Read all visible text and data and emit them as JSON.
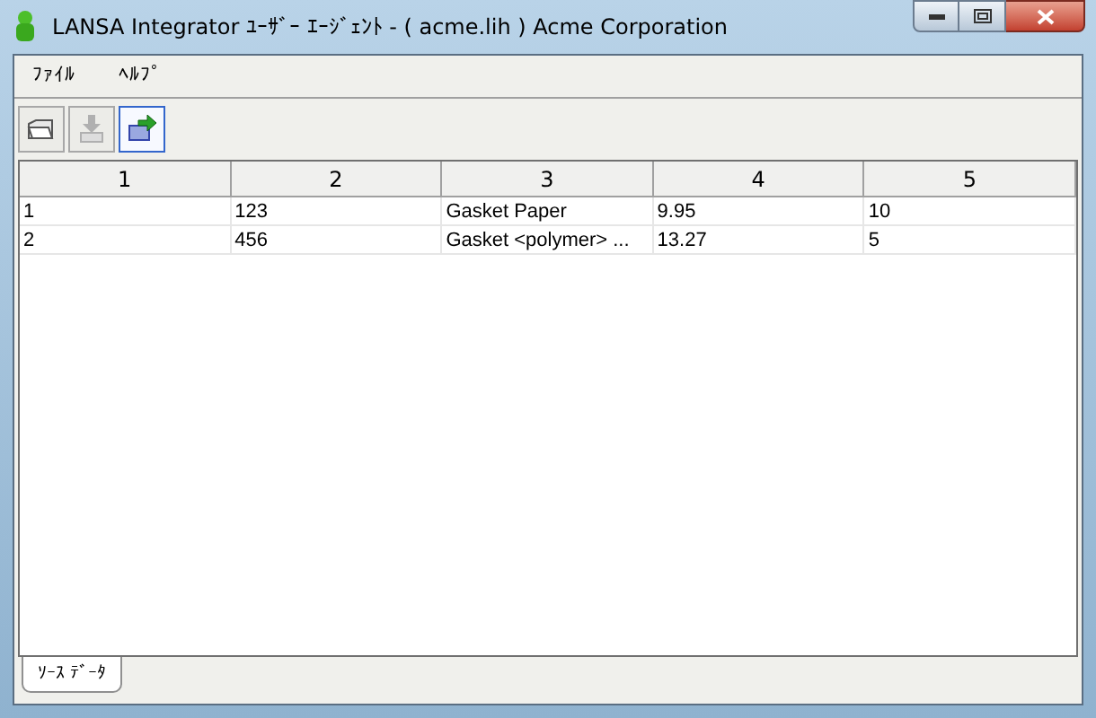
{
  "window": {
    "title": "LANSA Integrator ﾕｰｻﾞｰ ｴｰｼﾞｪﾝﾄ - ( acme.lih ) Acme Corporation"
  },
  "menu": [
    "ﾌｧｲﾙ",
    "ﾍﾙﾌﾟ"
  ],
  "toolbar": [
    {
      "kind": "open",
      "disabled": false,
      "selected": false
    },
    {
      "kind": "import",
      "disabled": true,
      "selected": false
    },
    {
      "kind": "export",
      "disabled": false,
      "selected": true
    }
  ],
  "table": {
    "columns": [
      "1",
      "2",
      "3",
      "4",
      "5"
    ],
    "rows": [
      [
        "1",
        "123",
        "Gasket Paper",
        "9.95",
        "10"
      ],
      [
        "2",
        "456",
        "Gasket <polymer> ...",
        "13.27",
        "5"
      ]
    ]
  },
  "tabs": [
    {
      "label": "ｿｰｽ ﾃﾞｰﾀ",
      "selected": true
    }
  ]
}
